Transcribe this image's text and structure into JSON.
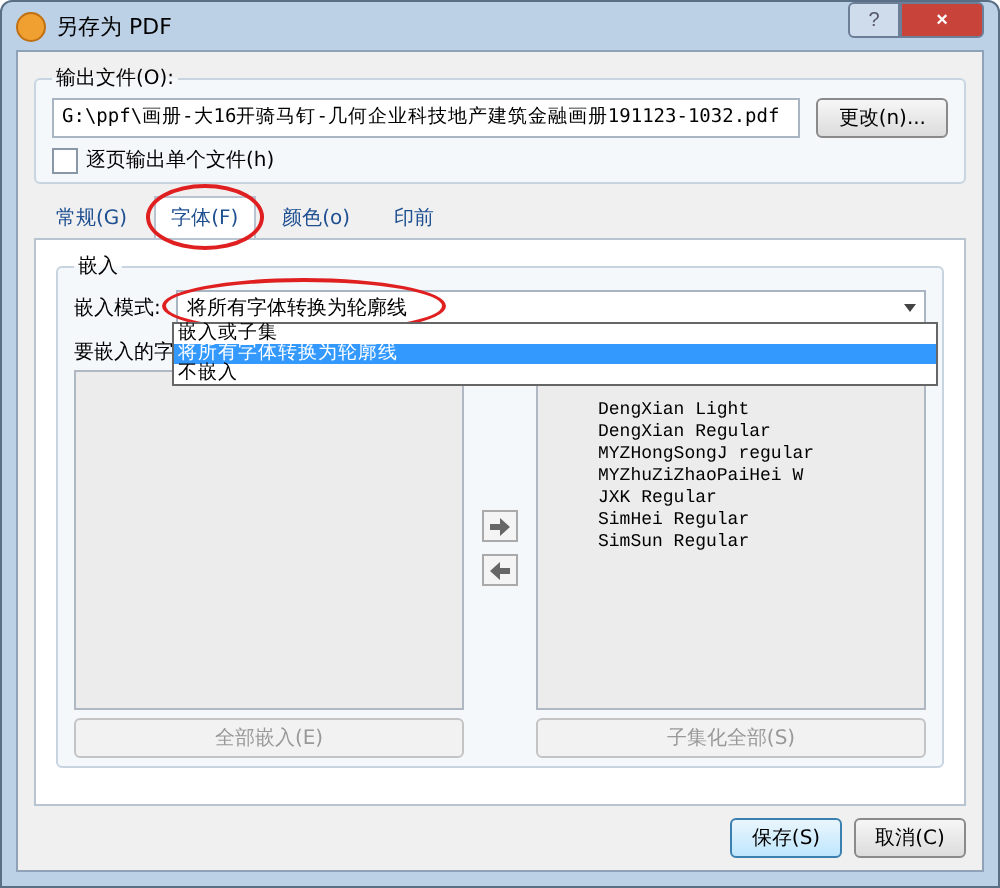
{
  "window": {
    "title": "另存为 PDF",
    "help": "?",
    "close": "×"
  },
  "output": {
    "label": "输出文件(O):",
    "path": "G:\\ppf\\画册-大16开骑马钉-几何企业科技地产建筑金融画册191123-1032.pdf",
    "change_button": "更改(n)...",
    "per_page": {
      "label": "逐页输出单个文件(h)",
      "checked": false
    }
  },
  "tabs": [
    {
      "label": "常规(G)",
      "selected": false,
      "circled": false
    },
    {
      "label": "字体(F)",
      "selected": true,
      "circled": true
    },
    {
      "label": "颜色(o)",
      "selected": false,
      "circled": false
    },
    {
      "label": "印前",
      "selected": false,
      "circled": false
    }
  ],
  "embed": {
    "title": "嵌入",
    "mode_label": "嵌入模式:",
    "mode_value": "将所有字体转换为轮廓线",
    "mode_circled": true,
    "options": [
      {
        "label": "嵌入或子集",
        "selected": false
      },
      {
        "label": "将所有字体转换为轮廓线",
        "selected": true
      },
      {
        "label": "不嵌入",
        "selected": false
      }
    ],
    "left_label": "要嵌入的字",
    "right_fonts": [
      "DengXian Light",
      "DengXian Regular",
      "MYZHongSongJ regular",
      "MYZhuZiZhaoPaiHei W",
      "JXK Regular",
      "SimHei Regular",
      "SimSun Regular"
    ],
    "embed_all": "全部嵌入(E)",
    "subset_all": "子集化全部(S)"
  },
  "buttons": [
    {
      "label": "保存(S)",
      "default": true
    },
    {
      "label": "取消(C)",
      "default": false
    }
  ]
}
